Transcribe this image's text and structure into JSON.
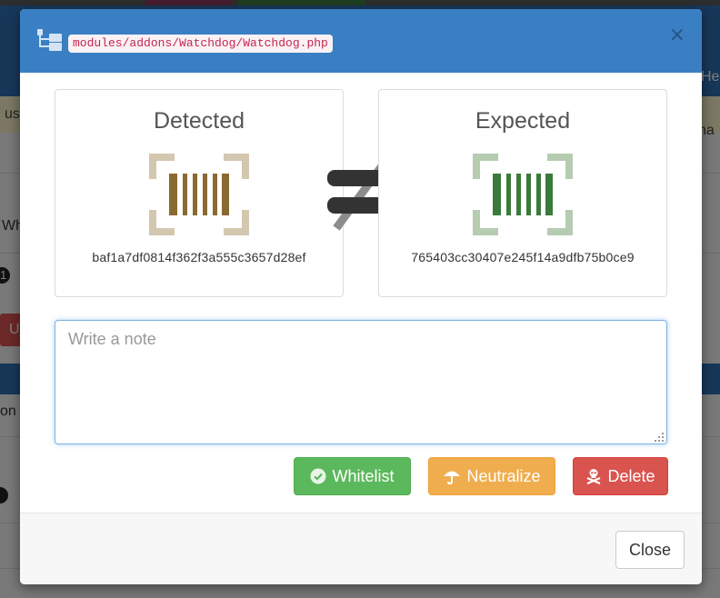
{
  "background": {
    "nav_fragment": "He",
    "warn_left_fragment": "us",
    "warn_right_fragment": "t ha",
    "row_fragment": "Wh",
    "count_fragment": "1",
    "red_button_fragment": "U",
    "section_fragment": "on"
  },
  "modal": {
    "file_path": "modules/addons/Watchdog/Watchdog.php",
    "close_glyph": "×",
    "header_icon": "sitemap-icon",
    "detected": {
      "title": "Detected",
      "hash": "baf1a7df0814f362f3a555c3657d28ef",
      "color": "#8a6a32",
      "frame_color": "#d4c7b0"
    },
    "expected": {
      "title": "Expected",
      "hash": "765403cc30407e245f14a9dfb75b0ce9",
      "color": "#3a7a3a",
      "frame_color": "#b5ccb0"
    },
    "note": {
      "placeholder": "Write a note",
      "value": ""
    },
    "buttons": {
      "whitelist": {
        "label": "Whitelist",
        "icon": "check-circle-icon",
        "color": "#5cb85c"
      },
      "neutralize": {
        "label": "Neutralize",
        "icon": "umbrella-icon",
        "color": "#f0ad4e"
      },
      "delete": {
        "label": "Delete",
        "icon": "skull-crossbones-icon",
        "color": "#d9534f"
      }
    },
    "footer": {
      "close_label": "Close"
    }
  },
  "colors": {
    "primary": "#3a7fc4",
    "code_text": "#c7254e"
  }
}
